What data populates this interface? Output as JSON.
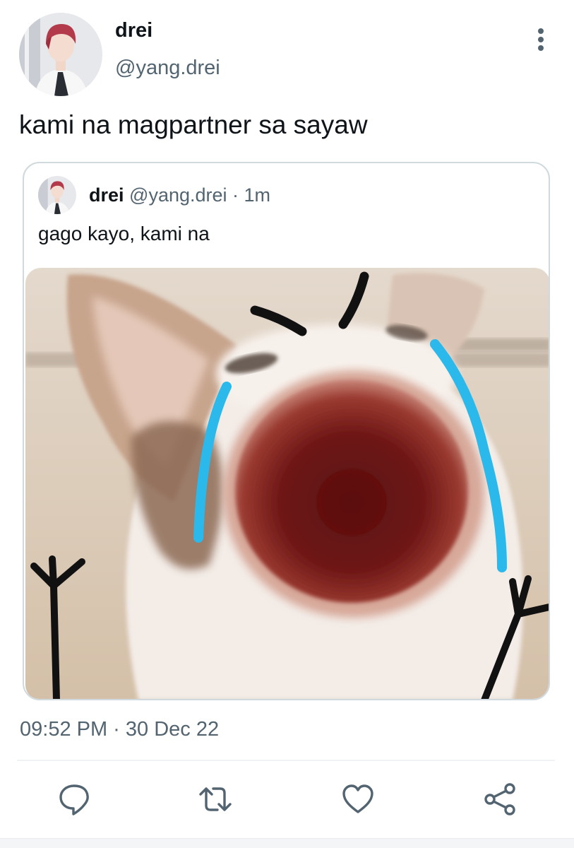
{
  "tweet": {
    "display_name": "drei",
    "handle": "@yang.drei",
    "text": "kami na magpartner sa sayaw",
    "timestamp": "09:52 PM · 30 Dec 22"
  },
  "quoted": {
    "display_name": "drei",
    "handle": "@yang.drei",
    "separator": " · ",
    "time": "1m",
    "text": "gago kayo, kami na"
  },
  "actions": [
    {
      "name": "reply",
      "icon": "speech-bubble-icon"
    },
    {
      "name": "retweet",
      "icon": "retweet-arrows-icon"
    },
    {
      "name": "like",
      "icon": "heart-icon"
    },
    {
      "name": "share",
      "icon": "share-nodes-icon"
    }
  ],
  "colors": {
    "text_primary": "#0f1419",
    "text_secondary": "#536471",
    "border": "#cfd9de",
    "tear_blue": "#2bb8ea"
  }
}
